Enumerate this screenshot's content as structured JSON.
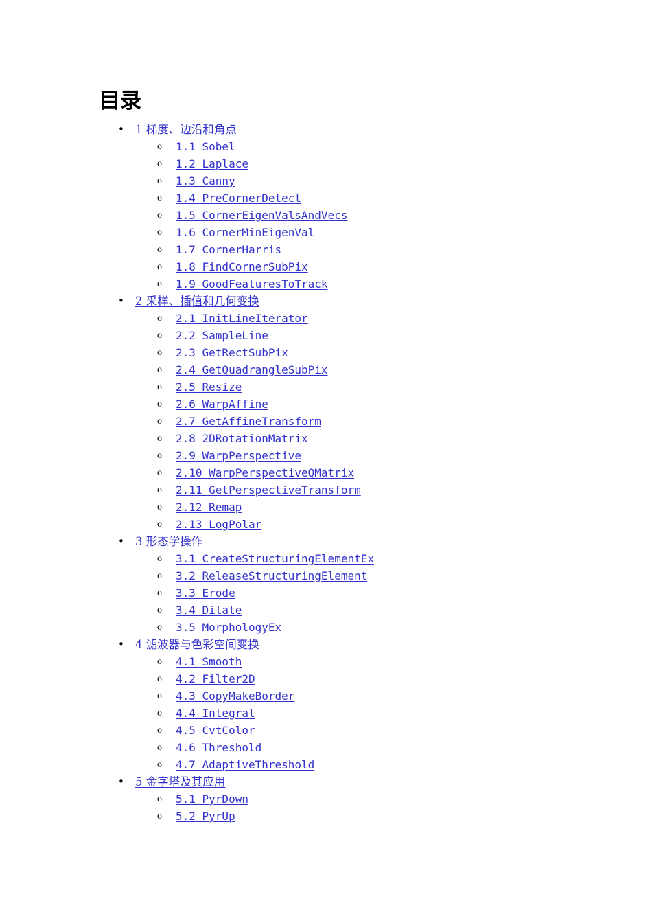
{
  "document": {
    "title": "目录",
    "link_color": "#3333CC",
    "text_color": "#000000",
    "background_color": "#FFFFFF"
  },
  "markers": {
    "level1_bullet": "•",
    "level2_bullet": "o"
  },
  "toc": {
    "sections": [
      {
        "label": "1 梯度、边沿和角点",
        "items": [
          {
            "label": "1.1 Sobel"
          },
          {
            "label": "1.2 Laplace"
          },
          {
            "label": "1.3 Canny"
          },
          {
            "label": "1.4 PreCornerDetect"
          },
          {
            "label": "1.5 CornerEigenValsAndVecs"
          },
          {
            "label": "1.6 CornerMinEigenVal"
          },
          {
            "label": "1.7 CornerHarris"
          },
          {
            "label": "1.8 FindCornerSubPix"
          },
          {
            "label": "1.9 GoodFeaturesToTrack"
          }
        ]
      },
      {
        "label": "2 采样、插值和几何变换",
        "items": [
          {
            "label": "2.1 InitLineIterator"
          },
          {
            "label": "2.2 SampleLine"
          },
          {
            "label": "2.3 GetRectSubPix"
          },
          {
            "label": "2.4 GetQuadrangleSubPix"
          },
          {
            "label": "2.5 Resize"
          },
          {
            "label": "2.6 WarpAffine"
          },
          {
            "label": "2.7 GetAffineTransform"
          },
          {
            "label": "2.8 2DRotationMatrix"
          },
          {
            "label": "2.9 WarpPerspective"
          },
          {
            "label": "2.10 WarpPerspectiveQMatrix"
          },
          {
            "label": "2.11 GetPerspectiveTransform"
          },
          {
            "label": "2.12 Remap"
          },
          {
            "label": "2.13 LogPolar"
          }
        ]
      },
      {
        "label": "3 形态学操作",
        "items": [
          {
            "label": "3.1 CreateStructuringElementEx"
          },
          {
            "label": "3.2 ReleaseStructuringElement"
          },
          {
            "label": "3.3 Erode"
          },
          {
            "label": "3.4 Dilate"
          },
          {
            "label": "3.5 MorphologyEx"
          }
        ]
      },
      {
        "label": "4 滤波器与色彩空间变换",
        "items": [
          {
            "label": "4.1 Smooth"
          },
          {
            "label": "4.2 Filter2D"
          },
          {
            "label": "4.3 CopyMakeBorder"
          },
          {
            "label": "4.4 Integral"
          },
          {
            "label": "4.5 CvtColor"
          },
          {
            "label": "4.6 Threshold"
          },
          {
            "label": "4.7 AdaptiveThreshold"
          }
        ]
      },
      {
        "label": "5 金字塔及其应用",
        "items": [
          {
            "label": "5.1 PyrDown"
          },
          {
            "label": "5.2 PyrUp"
          }
        ]
      }
    ]
  }
}
